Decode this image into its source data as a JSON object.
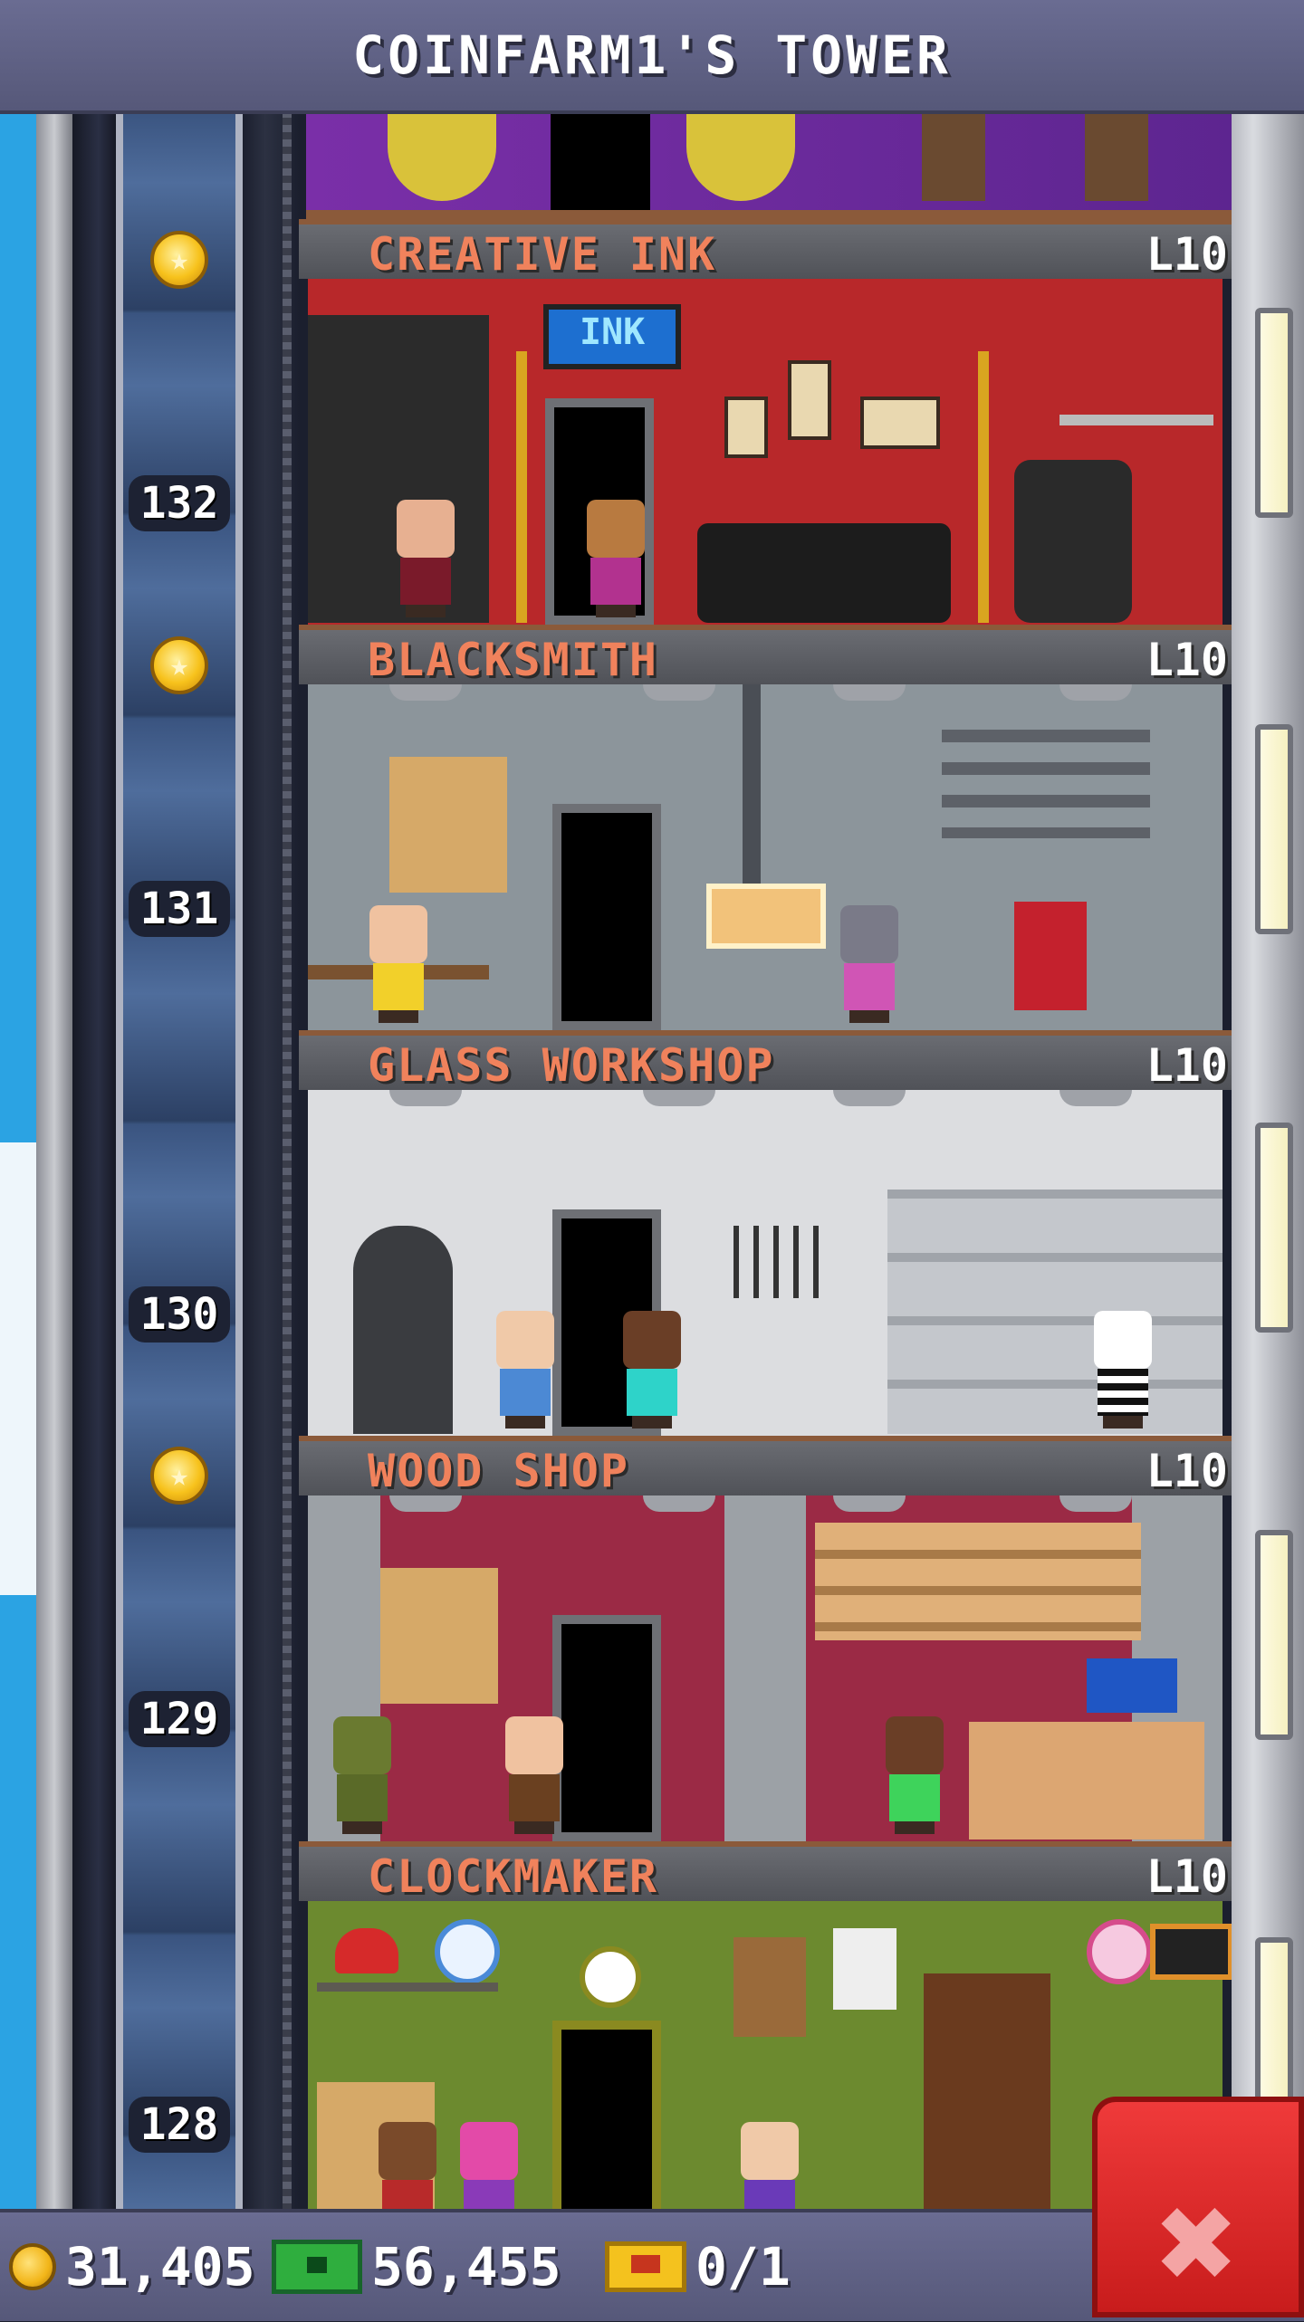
{
  "header": {
    "title": "COINFARM1'S TOWER"
  },
  "floors": [
    {
      "name": "CREATIVE INK",
      "level": "L10",
      "number": "132",
      "star": true,
      "room_color": "#b8282a"
    },
    {
      "name": "BLACKSMITH",
      "level": "L10",
      "number": "131",
      "star": true,
      "room_color": "#8c959b"
    },
    {
      "name": "GLASS WORKSHOP",
      "level": "L10",
      "number": "130",
      "star": false,
      "room_color": "#dcdde0"
    },
    {
      "name": "WOOD SHOP",
      "level": "L10",
      "number": "129",
      "star": true,
      "room_color": "#9b2a45"
    },
    {
      "name": "CLOCKMAKER",
      "level": "L10",
      "number": "128",
      "star": false,
      "room_color": "#6c8a2f"
    }
  ],
  "sign_text": "INK",
  "resources": {
    "coins": "31,405",
    "bux": "56,455",
    "vip": "0/1"
  },
  "icons": {
    "star": "star-icon",
    "coin": "coin-icon",
    "bux": "bux-icon",
    "vip": "vip-ticket-icon",
    "close": "close-icon"
  }
}
